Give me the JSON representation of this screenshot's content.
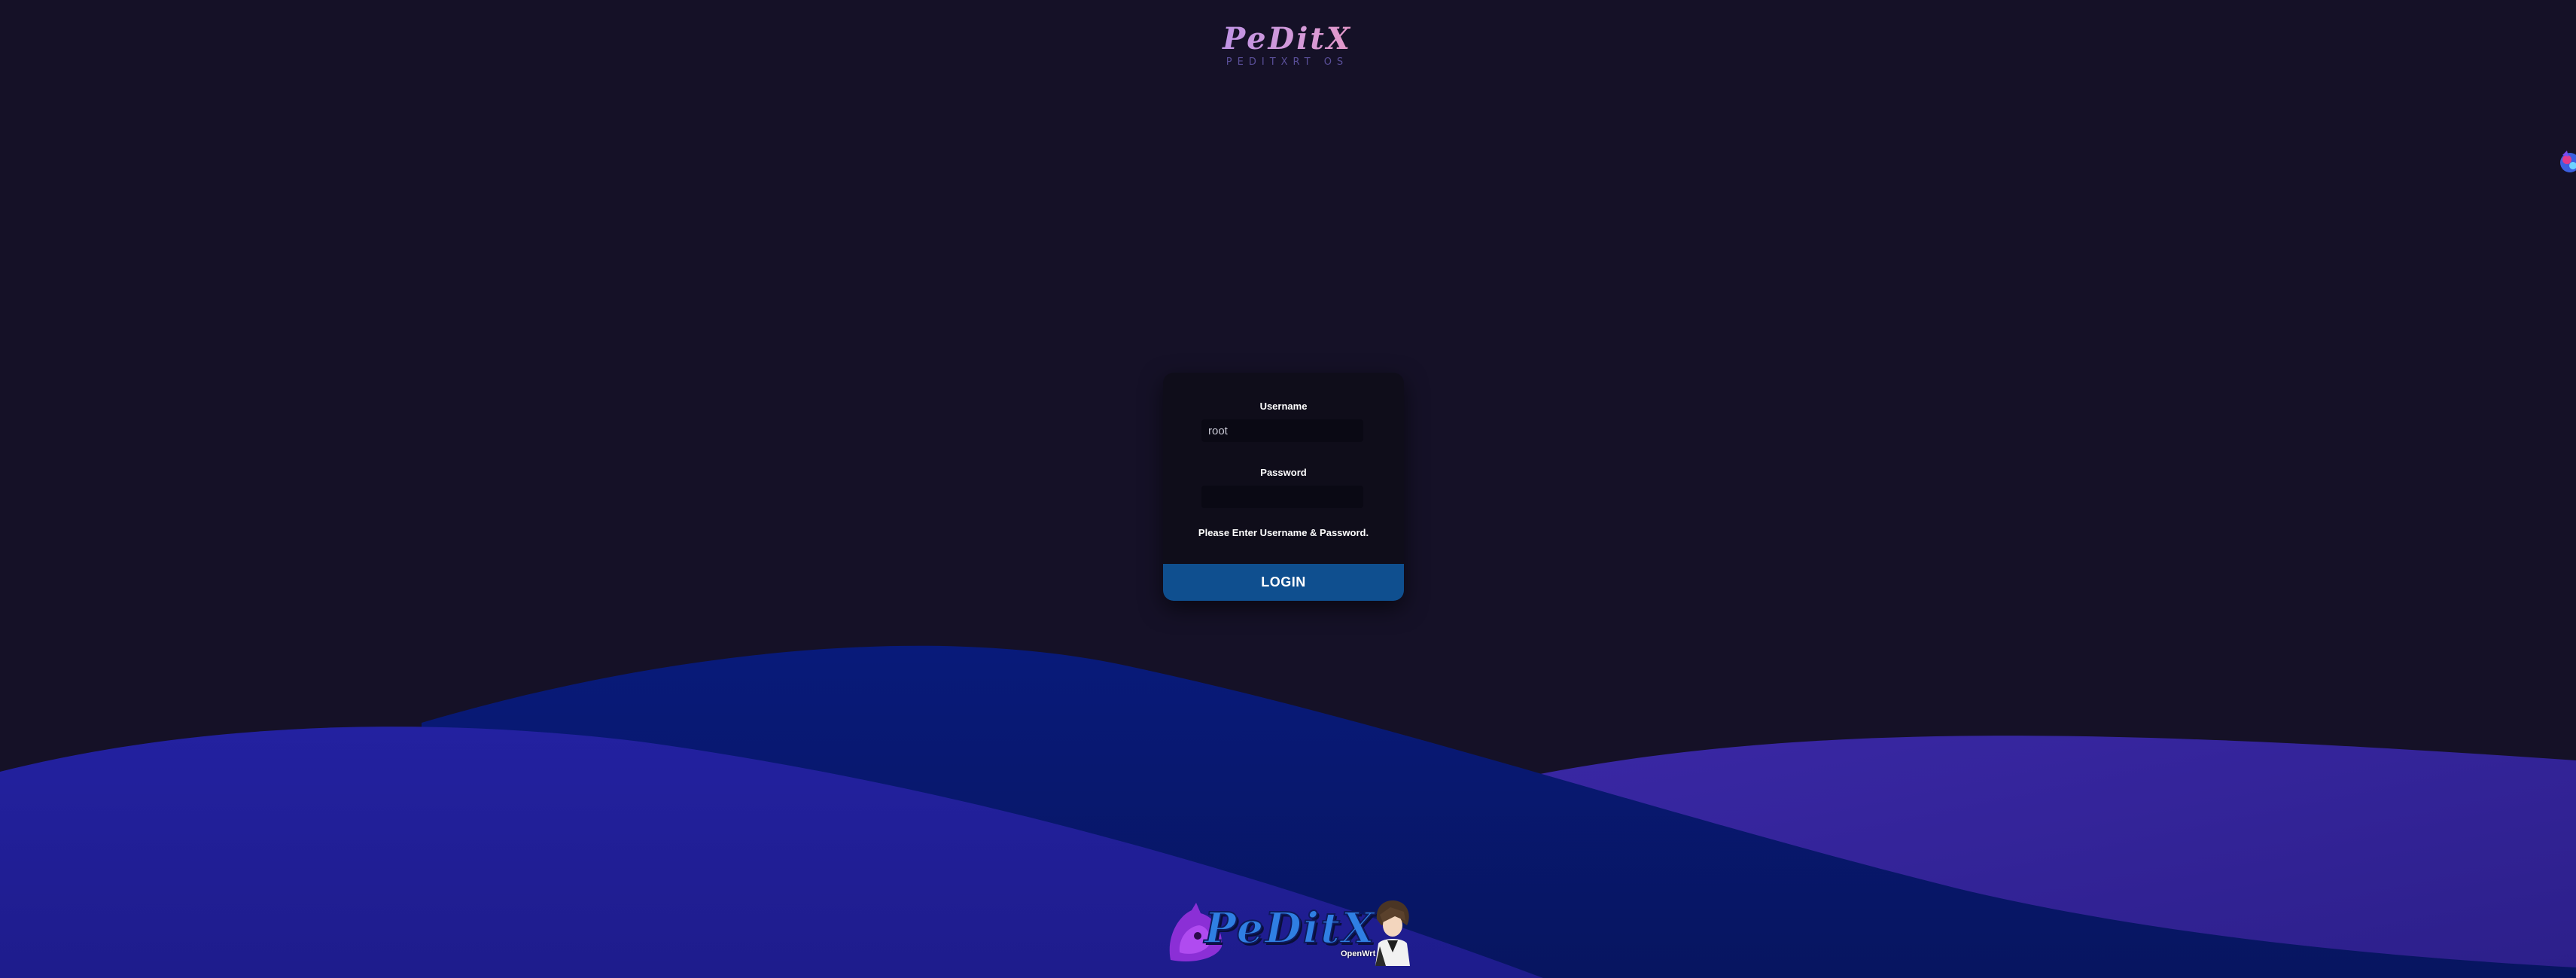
{
  "header": {
    "brand": "PeDitX",
    "subtitle": "PEDITXRT OS"
  },
  "login": {
    "username_label": "Username",
    "username_value": "root",
    "password_label": "Password",
    "password_value": "",
    "status_message": "Please Enter Username & Password.",
    "login_button": "LOGIN"
  },
  "footer": {
    "brand": "PeDitX",
    "subbrand": "OpenWrt"
  },
  "colors": {
    "background": "#151127",
    "card": "#0f0d1a",
    "login_button": "#0f4f8f",
    "wave_front": "#211f8e",
    "wave_mid": "#0b1c72",
    "wave_back": "#36249a"
  },
  "icons": {
    "side_widget": "floating-mascot-icon",
    "footer_mascot": "fox-mascot-icon",
    "footer_character": "anime-character-icon"
  }
}
